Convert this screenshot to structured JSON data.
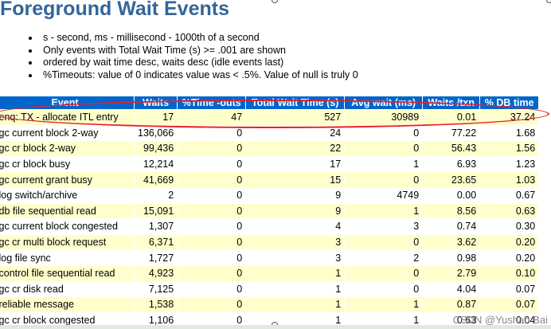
{
  "title": "Foreground Wait Events",
  "bullets": [
    "s - second, ms - millisecond - 1000th of a second",
    "Only events with Total Wait Time (s) >= .001 are shown",
    "ordered by wait time desc, waits desc (idle events last)",
    "%Timeouts: value of 0 indicates value was < .5%. Value of null is truly 0"
  ],
  "table": {
    "headers": [
      "Event",
      "Waits",
      "%Time -outs",
      "Total Wait Time (s)",
      "Avg wait (ms)",
      "Waits /txn",
      "% DB time"
    ],
    "rows": [
      [
        "enq: TX - allocate ITL entry",
        "17",
        "47",
        "527",
        "30989",
        "0.01",
        "37.24"
      ],
      [
        "gc current block 2-way",
        "136,066",
        "0",
        "24",
        "0",
        "77.22",
        "1.68"
      ],
      [
        "gc cr block 2-way",
        "99,436",
        "0",
        "22",
        "0",
        "56.43",
        "1.56"
      ],
      [
        "gc cr block busy",
        "12,214",
        "0",
        "17",
        "1",
        "6.93",
        "1.23"
      ],
      [
        "gc current grant busy",
        "41,669",
        "0",
        "15",
        "0",
        "23.65",
        "1.03"
      ],
      [
        "log switch/archive",
        "2",
        "0",
        "9",
        "4749",
        "0.00",
        "0.67"
      ],
      [
        "db file sequential read",
        "15,091",
        "0",
        "9",
        "1",
        "8.56",
        "0.63"
      ],
      [
        "gc current block congested",
        "1,307",
        "0",
        "4",
        "3",
        "0.74",
        "0.30"
      ],
      [
        "gc cr multi block request",
        "6,371",
        "0",
        "3",
        "0",
        "3.62",
        "0.20"
      ],
      [
        "log file sync",
        "1,727",
        "0",
        "3",
        "2",
        "0.98",
        "0.20"
      ],
      [
        "control file sequential read",
        "4,923",
        "0",
        "1",
        "0",
        "2.79",
        "0.10"
      ],
      [
        "gc cr disk read",
        "7,125",
        "0",
        "1",
        "0",
        "4.04",
        "0.07"
      ],
      [
        "reliable message",
        "1,538",
        "0",
        "1",
        "1",
        "0.87",
        "0.07"
      ],
      [
        "gc cr block congested",
        "1,106",
        "0",
        "1",
        "1",
        "0.63",
        "0.04"
      ]
    ]
  },
  "watermark": "CSDN @Yushan Bai",
  "colors": {
    "title": "#336699",
    "header_bg": "#0066cc",
    "row_alt": "#ffffcc",
    "highlight": "#e8202a"
  }
}
